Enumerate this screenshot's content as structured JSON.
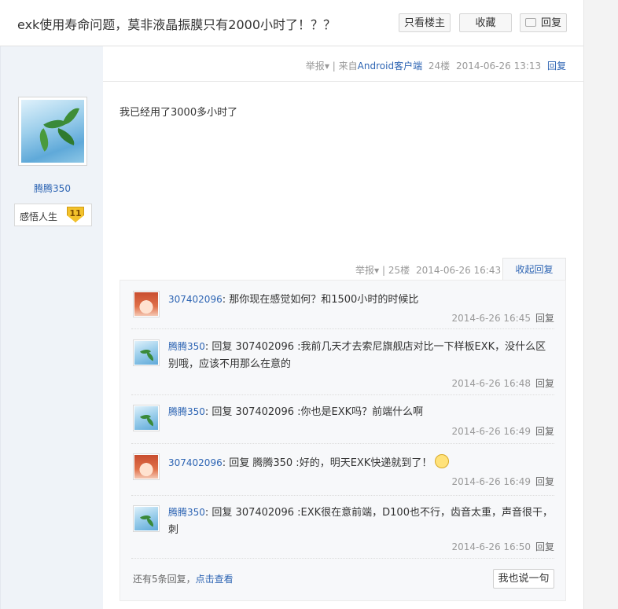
{
  "thread": {
    "title": "exk使用寿命问题，莫非液晶振膜只有2000小时了！？？",
    "buttons": {
      "only_op": "只看楼主",
      "favorite": "收藏",
      "reply": "回复"
    }
  },
  "post": {
    "meta": {
      "report": "举报",
      "source_prefix": "来自",
      "source": "Android客户端",
      "floor": "24楼",
      "datetime": "2014-06-26 13:13",
      "reply": "回复"
    },
    "author": {
      "name": "腾腾350",
      "badge_text": "感悟人生",
      "level": "11"
    },
    "content": "我已经用了3000多小时了"
  },
  "lzl": {
    "report": "举报",
    "floor": "25楼",
    "datetime": "2014-06-26 16:43",
    "collapse": "收起回复",
    "reply_label": "回复",
    "comments": [
      {
        "author": "307402096",
        "text": "那你现在感觉如何？和1500小时的时候比",
        "time": "2014-6-26 16:45",
        "avatar": "girl"
      },
      {
        "author": "腾腾350",
        "text": "回复 307402096 :我前几天才去索尼旗舰店对比一下样板EXK，没什么区别哦，应该不用那么在意的",
        "time": "2014-6-26 16:48",
        "avatar": "leaf"
      },
      {
        "author": "腾腾350",
        "text": "回复 307402096 :你也是EXK吗？前端什么啊",
        "time": "2014-6-26 16:49",
        "avatar": "leaf"
      },
      {
        "author": "307402096",
        "text": "回复 腾腾350 :好的，明天EXK快递就到了！",
        "time": "2014-6-26 16:49",
        "avatar": "girl",
        "emoji": "smiley-icon"
      },
      {
        "author": "腾腾350",
        "text": "回复 307402096 :EXK很在意前端，D100也不行，齿音太重，声音很干，刺",
        "time": "2014-6-26 16:50",
        "avatar": "leaf"
      }
    ],
    "more_prefix": "还有5条回复，",
    "more_link": "点击查看",
    "say_button": "我也说一句"
  }
}
